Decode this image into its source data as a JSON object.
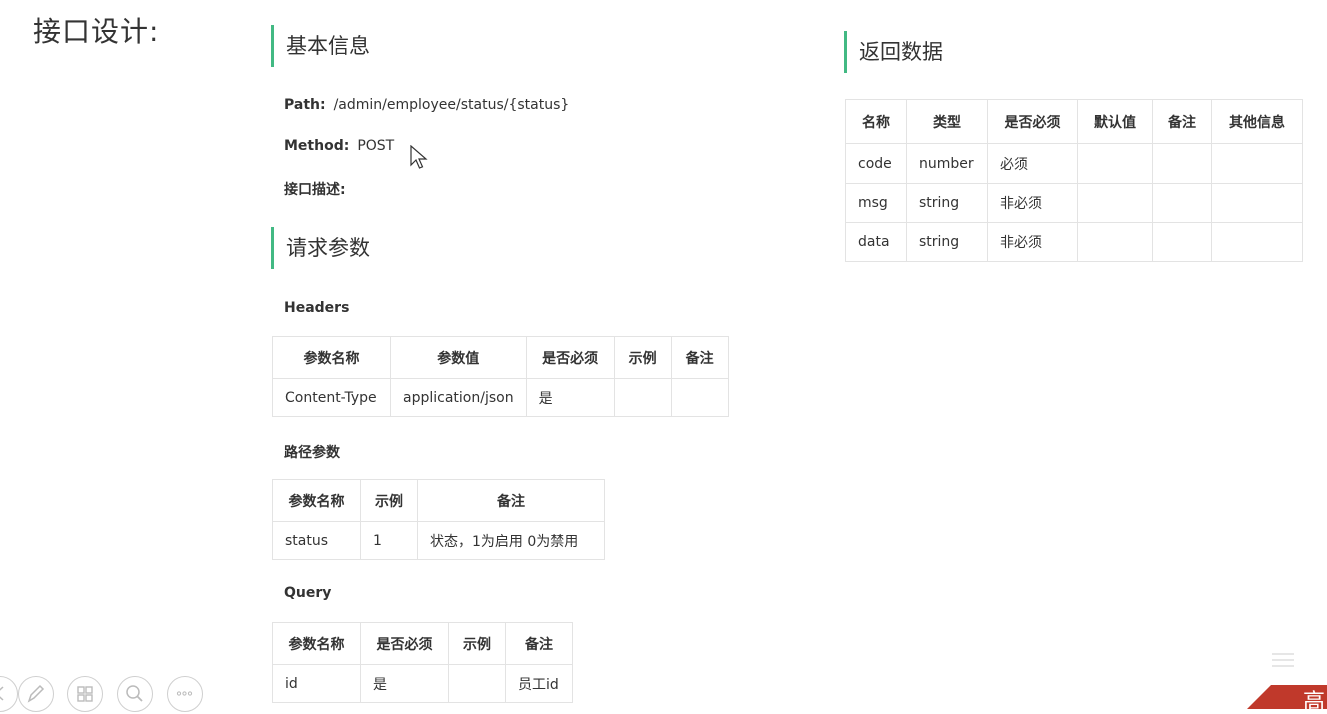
{
  "slide": {
    "title": "接口设计:"
  },
  "basic": {
    "heading": "基本信息",
    "path_label": "Path:",
    "path_value": "/admin/employee/status/{status}",
    "method_label": "Method:",
    "method_value": "POST",
    "desc_label": "接口描述:"
  },
  "request": {
    "heading": "请求参数",
    "headers": {
      "title": "Headers",
      "columns": [
        "参数名称",
        "参数值",
        "是否必须",
        "示例",
        "备注"
      ],
      "rows": [
        [
          "Content-Type",
          "application/json",
          "是",
          "",
          ""
        ]
      ]
    },
    "path_params": {
      "title": "路径参数",
      "columns": [
        "参数名称",
        "示例",
        "备注"
      ],
      "rows": [
        [
          "status",
          "1",
          "状态，1为启用 0为禁用"
        ]
      ]
    },
    "query": {
      "title": "Query",
      "columns": [
        "参数名称",
        "是否必须",
        "示例",
        "备注"
      ],
      "rows": [
        [
          "id",
          "是",
          "",
          "员工id"
        ]
      ]
    }
  },
  "response": {
    "heading": "返回数据",
    "columns": [
      "名称",
      "类型",
      "是否必须",
      "默认值",
      "备注",
      "其他信息"
    ],
    "rows": [
      [
        "code",
        "number",
        "必须",
        "",
        "",
        ""
      ],
      [
        "msg",
        "string",
        "非必须",
        "",
        "",
        ""
      ],
      [
        "data",
        "string",
        "非必须",
        "",
        "",
        ""
      ]
    ]
  },
  "colors": {
    "accent": "#42b983",
    "corner": "#c0392b"
  },
  "corner_glyph": "高"
}
